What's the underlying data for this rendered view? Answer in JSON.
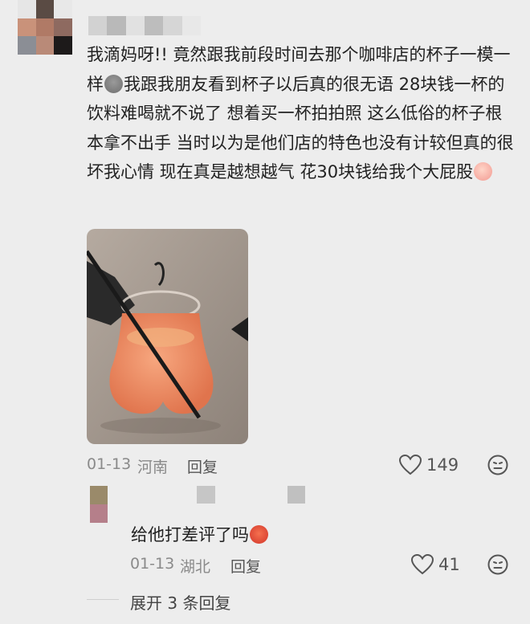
{
  "comment": {
    "text_part1": "我滴妈呀!! 竟然跟我前段时间去那个咖啡店的杯子一模一样",
    "emoji1": "ghost-face-emoji",
    "text_part2": "我跟我朋友看到杯子以后真的很无语 28块钱一杯的饮料难喝就不说了 想着买一杯拍拍照 这么低俗的杯子根本拿不出手 当时以为是他们店的特色也没有计较但真的很坏我心情 现在真是越想越气 花30块钱给我个大屁股",
    "emoji2": "crying-face-emoji",
    "date": "01-13",
    "location": "河南",
    "reply_label": "回复",
    "like_count": "149"
  },
  "reply": {
    "text": "给他打差评了吗",
    "emoji": "angry-devil-emoji",
    "date": "01-13",
    "location": "湖北",
    "reply_label": "回复",
    "like_count": "41"
  },
  "expand": {
    "label": "展开 3 条回复"
  },
  "colors": {
    "background": "#ededed",
    "meta_text": "#8a8a8a",
    "drink_orange": "#f08a5d"
  }
}
